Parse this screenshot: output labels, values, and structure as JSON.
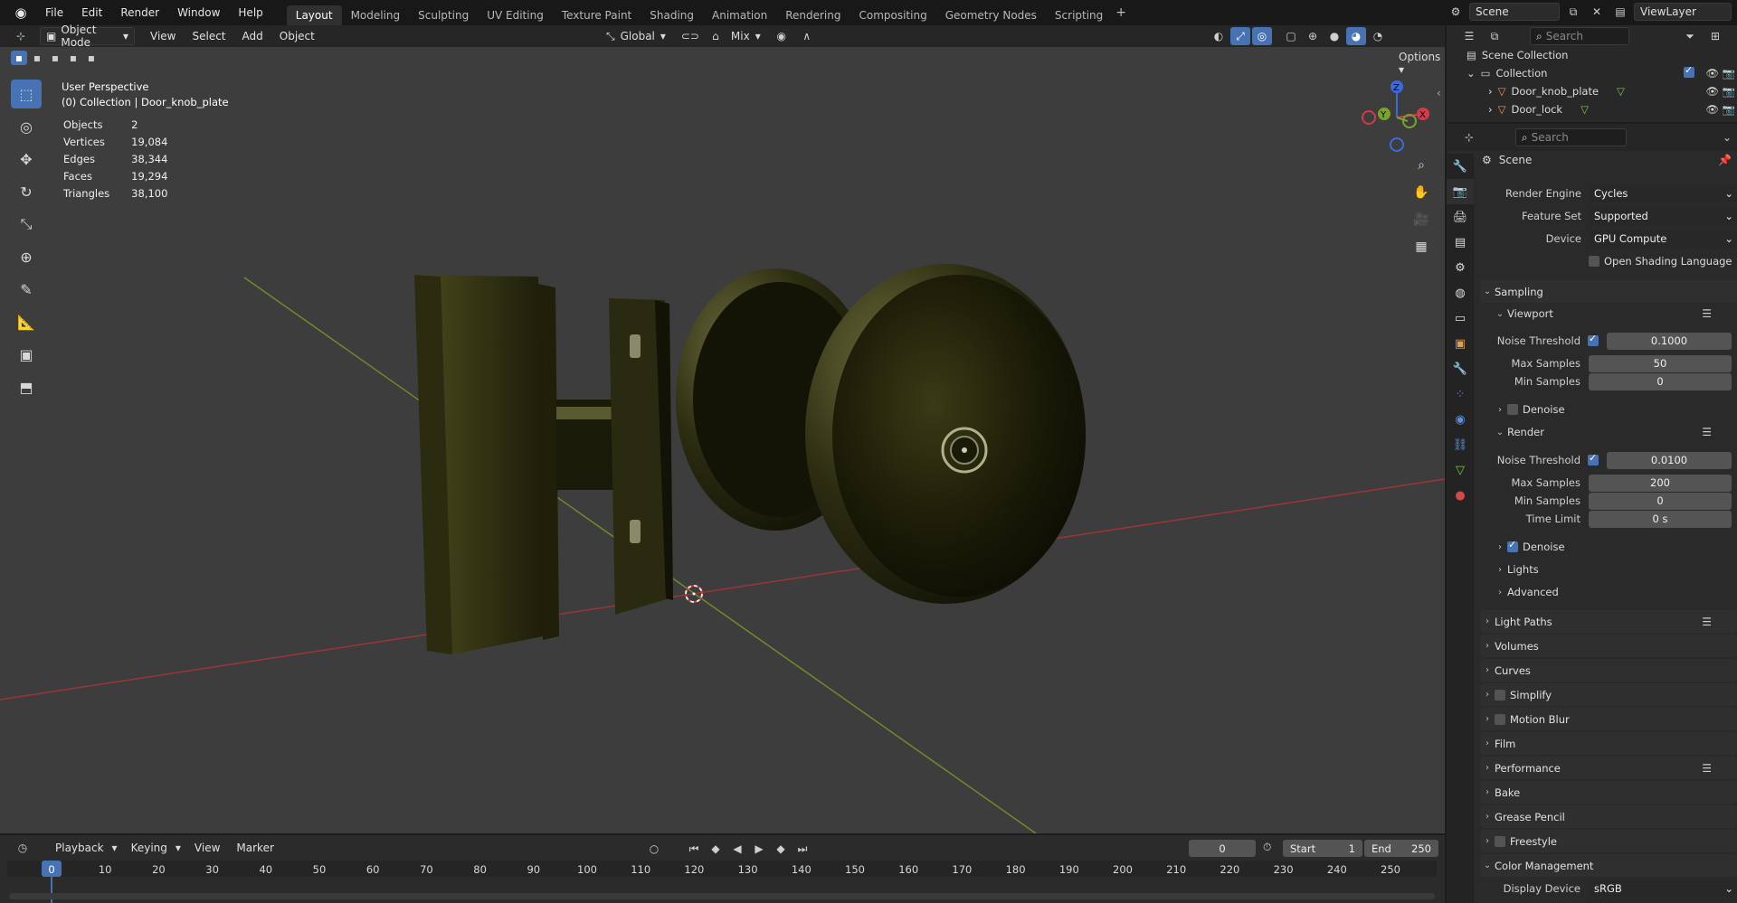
{
  "app": {
    "logo_icon": "blender-icon",
    "menus": [
      "File",
      "Edit",
      "Render",
      "Window",
      "Help"
    ]
  },
  "workspaces": {
    "tabs": [
      "Layout",
      "Modeling",
      "Sculpting",
      "UV Editing",
      "Texture Paint",
      "Shading",
      "Animation",
      "Rendering",
      "Compositing",
      "Geometry Nodes",
      "Scripting"
    ],
    "active": "Layout"
  },
  "topright": {
    "scene": "Scene",
    "view_layer": "ViewLayer"
  },
  "viewport_header": {
    "mode": "Object Mode",
    "menus": [
      "View",
      "Select",
      "Add",
      "Object"
    ],
    "orientation": "Global",
    "snap_mode": "Mix",
    "options": "Options"
  },
  "viewport": {
    "perspective": "User Perspective",
    "collection_line": "(0) Collection | Door_knob_plate",
    "stats": [
      {
        "label": "Objects",
        "value": "2"
      },
      {
        "label": "Vertices",
        "value": "19,084"
      },
      {
        "label": "Edges",
        "value": "38,344"
      },
      {
        "label": "Faces",
        "value": "19,294"
      },
      {
        "label": "Triangles",
        "value": "38,100"
      }
    ],
    "gizmo": {
      "x": "X",
      "y": "Y",
      "z": "Z"
    }
  },
  "outliner": {
    "search_placeholder": "Search",
    "root": "Scene Collection",
    "collection": "Collection",
    "objects": [
      "Door_knob_plate",
      "Door_lock"
    ]
  },
  "properties": {
    "search_placeholder": "Search",
    "context": "Scene",
    "render_engine_label": "Render Engine",
    "render_engine": "Cycles",
    "feature_set_label": "Feature Set",
    "feature_set": "Supported",
    "device_label": "Device",
    "device": "GPU Compute",
    "osl": "Open Shading Language",
    "sampling": "Sampling",
    "viewport": "Viewport",
    "noise_threshold_label": "Noise Threshold",
    "vp_noise": "0.1000",
    "max_samples_label": "Max Samples",
    "vp_max": "50",
    "min_samples_label": "Min Samples",
    "vp_min": "0",
    "denoise": "Denoise",
    "render": "Render",
    "r_noise": "0.0100",
    "r_max": "200",
    "r_min": "0",
    "time_limit_label": "Time Limit",
    "time_limit": "0 s",
    "lights": "Lights",
    "advanced": "Advanced",
    "panels": [
      "Light Paths",
      "Volumes",
      "Curves",
      "Simplify",
      "Motion Blur",
      "Film",
      "Performance",
      "Bake",
      "Grease Pencil",
      "Freestyle",
      "Color Management"
    ],
    "display_device_label": "Display Device",
    "display_device": "sRGB"
  },
  "timeline": {
    "menus": [
      "Playback",
      "Keying",
      "View",
      "Marker"
    ],
    "current_frame": "0",
    "start_label": "Start",
    "start": "1",
    "end_label": "End",
    "end": "250",
    "ticks": [
      "0",
      "10",
      "20",
      "30",
      "40",
      "50",
      "60",
      "70",
      "80",
      "90",
      "100",
      "110",
      "120",
      "130",
      "140",
      "150",
      "160",
      "170",
      "180",
      "190",
      "200",
      "210",
      "220",
      "230",
      "240",
      "250"
    ]
  }
}
